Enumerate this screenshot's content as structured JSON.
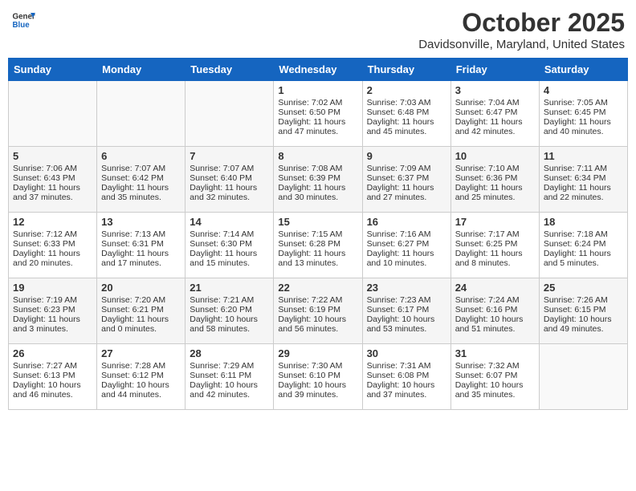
{
  "header": {
    "logo_line1": "General",
    "logo_line2": "Blue",
    "month_title": "October 2025",
    "location": "Davidsonville, Maryland, United States"
  },
  "weekdays": [
    "Sunday",
    "Monday",
    "Tuesday",
    "Wednesday",
    "Thursday",
    "Friday",
    "Saturday"
  ],
  "weeks": [
    [
      {
        "day": "",
        "info": ""
      },
      {
        "day": "",
        "info": ""
      },
      {
        "day": "",
        "info": ""
      },
      {
        "day": "1",
        "info": "Sunrise: 7:02 AM\nSunset: 6:50 PM\nDaylight: 11 hours\nand 47 minutes."
      },
      {
        "day": "2",
        "info": "Sunrise: 7:03 AM\nSunset: 6:48 PM\nDaylight: 11 hours\nand 45 minutes."
      },
      {
        "day": "3",
        "info": "Sunrise: 7:04 AM\nSunset: 6:47 PM\nDaylight: 11 hours\nand 42 minutes."
      },
      {
        "day": "4",
        "info": "Sunrise: 7:05 AM\nSunset: 6:45 PM\nDaylight: 11 hours\nand 40 minutes."
      }
    ],
    [
      {
        "day": "5",
        "info": "Sunrise: 7:06 AM\nSunset: 6:43 PM\nDaylight: 11 hours\nand 37 minutes."
      },
      {
        "day": "6",
        "info": "Sunrise: 7:07 AM\nSunset: 6:42 PM\nDaylight: 11 hours\nand 35 minutes."
      },
      {
        "day": "7",
        "info": "Sunrise: 7:07 AM\nSunset: 6:40 PM\nDaylight: 11 hours\nand 32 minutes."
      },
      {
        "day": "8",
        "info": "Sunrise: 7:08 AM\nSunset: 6:39 PM\nDaylight: 11 hours\nand 30 minutes."
      },
      {
        "day": "9",
        "info": "Sunrise: 7:09 AM\nSunset: 6:37 PM\nDaylight: 11 hours\nand 27 minutes."
      },
      {
        "day": "10",
        "info": "Sunrise: 7:10 AM\nSunset: 6:36 PM\nDaylight: 11 hours\nand 25 minutes."
      },
      {
        "day": "11",
        "info": "Sunrise: 7:11 AM\nSunset: 6:34 PM\nDaylight: 11 hours\nand 22 minutes."
      }
    ],
    [
      {
        "day": "12",
        "info": "Sunrise: 7:12 AM\nSunset: 6:33 PM\nDaylight: 11 hours\nand 20 minutes."
      },
      {
        "day": "13",
        "info": "Sunrise: 7:13 AM\nSunset: 6:31 PM\nDaylight: 11 hours\nand 17 minutes."
      },
      {
        "day": "14",
        "info": "Sunrise: 7:14 AM\nSunset: 6:30 PM\nDaylight: 11 hours\nand 15 minutes."
      },
      {
        "day": "15",
        "info": "Sunrise: 7:15 AM\nSunset: 6:28 PM\nDaylight: 11 hours\nand 13 minutes."
      },
      {
        "day": "16",
        "info": "Sunrise: 7:16 AM\nSunset: 6:27 PM\nDaylight: 11 hours\nand 10 minutes."
      },
      {
        "day": "17",
        "info": "Sunrise: 7:17 AM\nSunset: 6:25 PM\nDaylight: 11 hours\nand 8 minutes."
      },
      {
        "day": "18",
        "info": "Sunrise: 7:18 AM\nSunset: 6:24 PM\nDaylight: 11 hours\nand 5 minutes."
      }
    ],
    [
      {
        "day": "19",
        "info": "Sunrise: 7:19 AM\nSunset: 6:23 PM\nDaylight: 11 hours\nand 3 minutes."
      },
      {
        "day": "20",
        "info": "Sunrise: 7:20 AM\nSunset: 6:21 PM\nDaylight: 11 hours\nand 0 minutes."
      },
      {
        "day": "21",
        "info": "Sunrise: 7:21 AM\nSunset: 6:20 PM\nDaylight: 10 hours\nand 58 minutes."
      },
      {
        "day": "22",
        "info": "Sunrise: 7:22 AM\nSunset: 6:19 PM\nDaylight: 10 hours\nand 56 minutes."
      },
      {
        "day": "23",
        "info": "Sunrise: 7:23 AM\nSunset: 6:17 PM\nDaylight: 10 hours\nand 53 minutes."
      },
      {
        "day": "24",
        "info": "Sunrise: 7:24 AM\nSunset: 6:16 PM\nDaylight: 10 hours\nand 51 minutes."
      },
      {
        "day": "25",
        "info": "Sunrise: 7:26 AM\nSunset: 6:15 PM\nDaylight: 10 hours\nand 49 minutes."
      }
    ],
    [
      {
        "day": "26",
        "info": "Sunrise: 7:27 AM\nSunset: 6:13 PM\nDaylight: 10 hours\nand 46 minutes."
      },
      {
        "day": "27",
        "info": "Sunrise: 7:28 AM\nSunset: 6:12 PM\nDaylight: 10 hours\nand 44 minutes."
      },
      {
        "day": "28",
        "info": "Sunrise: 7:29 AM\nSunset: 6:11 PM\nDaylight: 10 hours\nand 42 minutes."
      },
      {
        "day": "29",
        "info": "Sunrise: 7:30 AM\nSunset: 6:10 PM\nDaylight: 10 hours\nand 39 minutes."
      },
      {
        "day": "30",
        "info": "Sunrise: 7:31 AM\nSunset: 6:08 PM\nDaylight: 10 hours\nand 37 minutes."
      },
      {
        "day": "31",
        "info": "Sunrise: 7:32 AM\nSunset: 6:07 PM\nDaylight: 10 hours\nand 35 minutes."
      },
      {
        "day": "",
        "info": ""
      }
    ]
  ]
}
